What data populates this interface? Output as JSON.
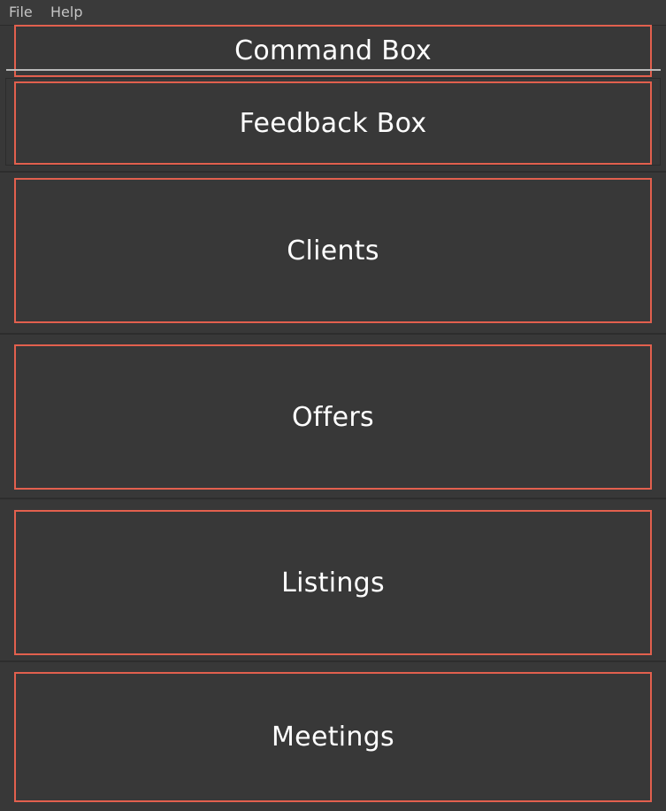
{
  "menu": {
    "file": "File",
    "help": "Help"
  },
  "panels": {
    "command_box": "Command Box",
    "feedback_box": "Feedback Box",
    "clients": "Clients",
    "offers": "Offers",
    "listings": "Listings",
    "meetings": "Meetings"
  },
  "colors": {
    "background": "#383838",
    "box_border": "#e2604e",
    "text": "#ffffff",
    "menu_text": "#c4c4c4"
  }
}
